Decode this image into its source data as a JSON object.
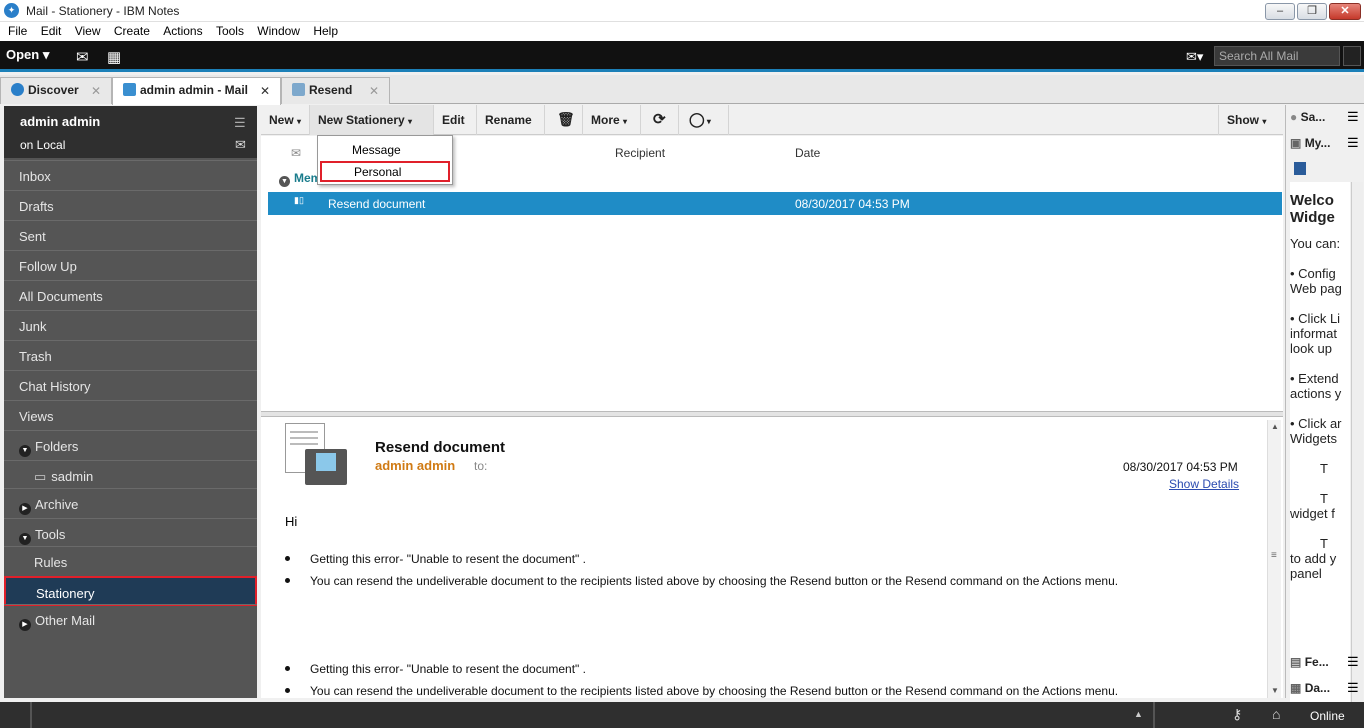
{
  "window": {
    "title": "Mail - Stationery - IBM Notes"
  },
  "menu": [
    "File",
    "Edit",
    "View",
    "Create",
    "Actions",
    "Tools",
    "Window",
    "Help"
  ],
  "toolbar": {
    "open_label": "Open",
    "search_placeholder": "Search All Mail"
  },
  "tabs": [
    {
      "label": "Discover"
    },
    {
      "label": "admin admin - Mail"
    },
    {
      "label": "Resend"
    }
  ],
  "sidebar": {
    "user": "admin admin",
    "location": "on Local",
    "items": [
      "Inbox",
      "Drafts",
      "Sent",
      "Follow Up",
      "All Documents",
      "Junk",
      "Trash",
      "Chat History",
      "Views",
      "Folders",
      "sadmin",
      "Archive",
      "Tools",
      "Rules",
      "Stationery",
      "Other Mail"
    ]
  },
  "actions": {
    "new": "New",
    "new_stationery": "New Stationery",
    "edit": "Edit",
    "rename": "Rename",
    "more": "More",
    "show": "Show"
  },
  "dropdown": {
    "items": [
      "Message",
      "Personal"
    ]
  },
  "list": {
    "columns": {
      "recipient": "Recipient",
      "date": "Date"
    },
    "group": "Mem",
    "rows": [
      {
        "subject": "Resend document",
        "date": "08/30/2017 04:53 PM"
      }
    ]
  },
  "preview": {
    "subject": "Resend document",
    "from": "admin admin",
    "to_label": "to:",
    "date": "08/30/2017 04:53 PM",
    "details_link": "Show Details",
    "greeting": "Hi",
    "bullet1": "Getting this error- \"Unable to resent the document\" .",
    "bullet2": "You can resend the undeliverable document to the recipients listed above by choosing the Resend button or the Resend command on the Actions menu."
  },
  "rightpanel": {
    "tabs": [
      "Sa...",
      "My...",
      "Fe...",
      "Da..."
    ],
    "welcome_title_1": "Welco",
    "welcome_title_2": "Widge",
    "lines": [
      "You can:",
      "",
      "• Config",
      "Web pag",
      "",
      "• Click Li",
      "informat",
      "look up",
      "",
      "• Extend",
      "actions y",
      "",
      "• Click ar",
      "Widgets",
      "",
      "T",
      "",
      "T",
      "widget f",
      "",
      "T",
      "to add y",
      "panel"
    ]
  },
  "status": {
    "online": "Online"
  },
  "colors": {
    "accent": "#1f8cc6",
    "highlight": "#e0202a",
    "sender": "#d07a13"
  }
}
